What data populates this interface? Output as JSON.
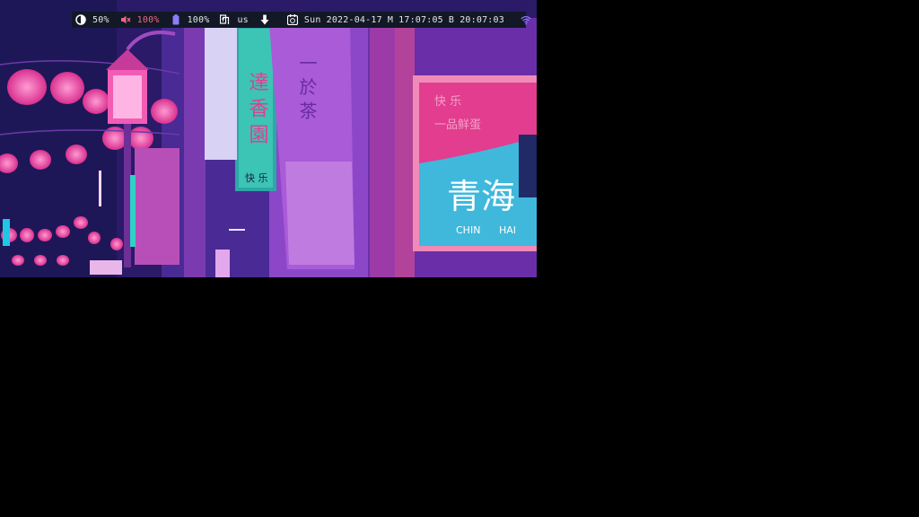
{
  "statusbar": {
    "brightness": {
      "icon": "brightness-icon",
      "value": "50%"
    },
    "volume": {
      "icon": "volume-muted-icon",
      "value": "100%",
      "muted": true,
      "color": "#f06585"
    },
    "battery": {
      "icon": "battery-icon",
      "value": "100%",
      "color": "#8a7dff"
    },
    "keyboard": {
      "icon": "keyboard-layout-icon",
      "layout": "us"
    },
    "download": {
      "icon": "download-arrow-icon"
    },
    "clock": {
      "icon": "clock-icon",
      "day": "Sun",
      "date": "2022-04-17",
      "zone_a": "M",
      "time_a": "17:07:05",
      "zone_b": "B",
      "time_b": "20:07:03"
    },
    "wifi": {
      "icon": "wifi-icon",
      "color": "#8a7dff"
    }
  },
  "wallpaper": {
    "sign_cn": "青海",
    "sign_latin_left": "CHIN",
    "sign_latin_right": "HAI",
    "sign_top_left": "快 乐",
    "sign_top_right": "一品鲜蛋",
    "banner_left": "達 香 園",
    "banner_left_small": "快 乐",
    "banner_mid": "一 於 茶"
  }
}
